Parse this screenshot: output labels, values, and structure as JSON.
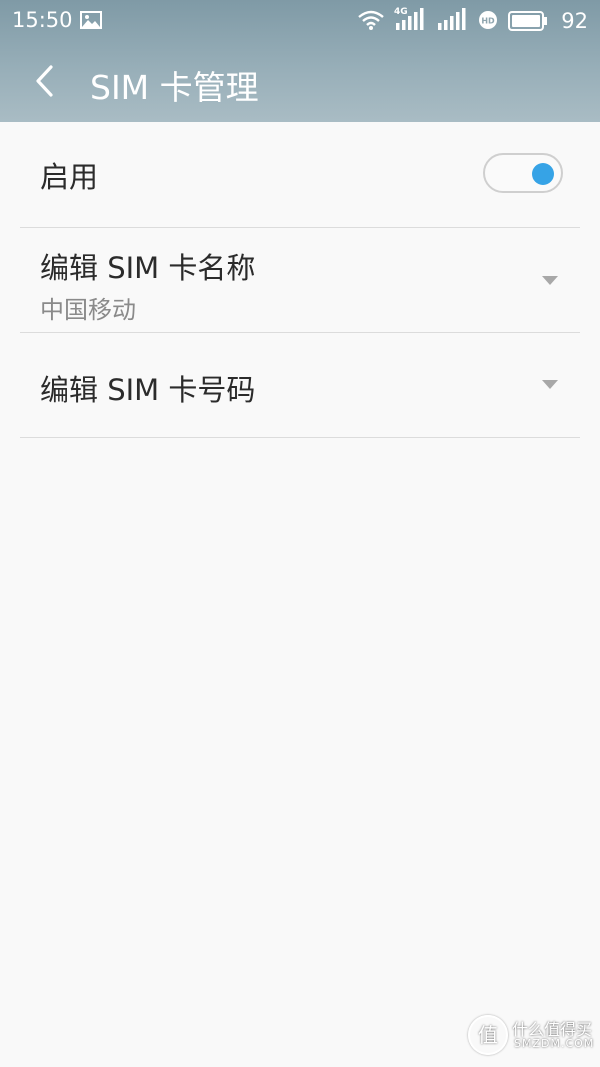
{
  "status_bar": {
    "time": "15:50",
    "network_type": "4G",
    "battery_level": "92",
    "icons": [
      "gallery-icon",
      "wifi-icon",
      "signal-4g-icon",
      "signal-icon",
      "hd-icon",
      "battery-icon"
    ]
  },
  "header": {
    "title": "SIM 卡管理",
    "back_icon": "chevron-left-icon"
  },
  "settings": {
    "enable": {
      "label": "启用",
      "toggle_on": true
    },
    "edit_name": {
      "label": "编辑 SIM 卡名称",
      "value": "中国移动"
    },
    "edit_number": {
      "label": "编辑 SIM 卡号码"
    }
  },
  "watermark": {
    "glyph": "值",
    "text": "什么值得买",
    "sub": "SMZDM.COM"
  },
  "colors": {
    "header_bg": "#97aeb8",
    "accent": "#36a3e6",
    "background": "#f9f9f9",
    "divider": "#dcdcdc"
  }
}
